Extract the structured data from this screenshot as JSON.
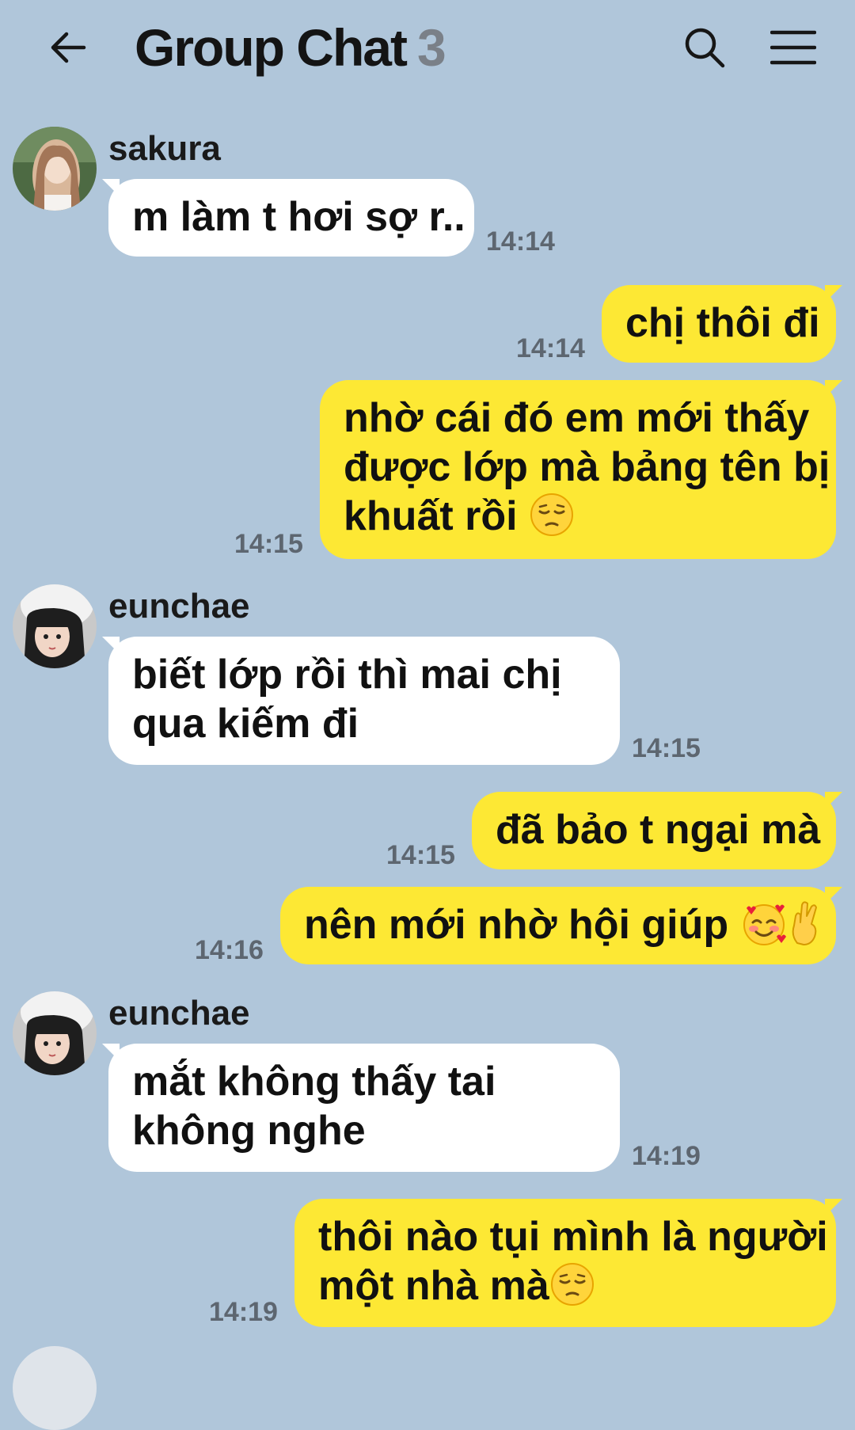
{
  "header": {
    "title": "Group Chat",
    "member_count": "3",
    "back_icon": "arrow-left-icon",
    "search_icon": "search-icon",
    "menu_icon": "hamburger-menu-icon"
  },
  "colors": {
    "background": "#b0c6da",
    "incoming_bubble": "#ffffff",
    "outgoing_bubble": "#fde834",
    "timestamp": "#5d6670",
    "member_count": "#7a8088"
  },
  "messages": [
    {
      "sender": "sakura",
      "direction": "incoming",
      "text": "m làm t hơi sợ r..",
      "time": "14:14"
    },
    {
      "direction": "outgoing",
      "text": "chị thôi đi",
      "time": "14:14"
    },
    {
      "direction": "outgoing",
      "lines": [
        "nhờ cái đó em mới thấy",
        "được lớp mà bảng tên bị",
        "khuất rồi"
      ],
      "emoji": "pensive-face",
      "time": "14:15"
    },
    {
      "sender": "eunchae",
      "direction": "incoming",
      "lines": [
        "biết lớp rồi thì mai chị",
        "qua kiếm đi"
      ],
      "time": "14:15"
    },
    {
      "direction": "outgoing",
      "text": "đã bảo t ngại mà",
      "time": "14:15"
    },
    {
      "direction": "outgoing",
      "text": "nên mới nhờ hội giúp",
      "emoji": [
        "smiling-face-with-hearts",
        "crossed-fingers"
      ],
      "time": "14:16"
    },
    {
      "sender": "eunchae",
      "direction": "incoming",
      "lines": [
        "mắt không thấy tai",
        "không nghe"
      ],
      "time": "14:19"
    },
    {
      "direction": "outgoing",
      "lines": [
        "thôi nào tụi mình là người",
        "một nhà mà"
      ],
      "emoji": "pensive-face",
      "time": "14:19"
    }
  ]
}
